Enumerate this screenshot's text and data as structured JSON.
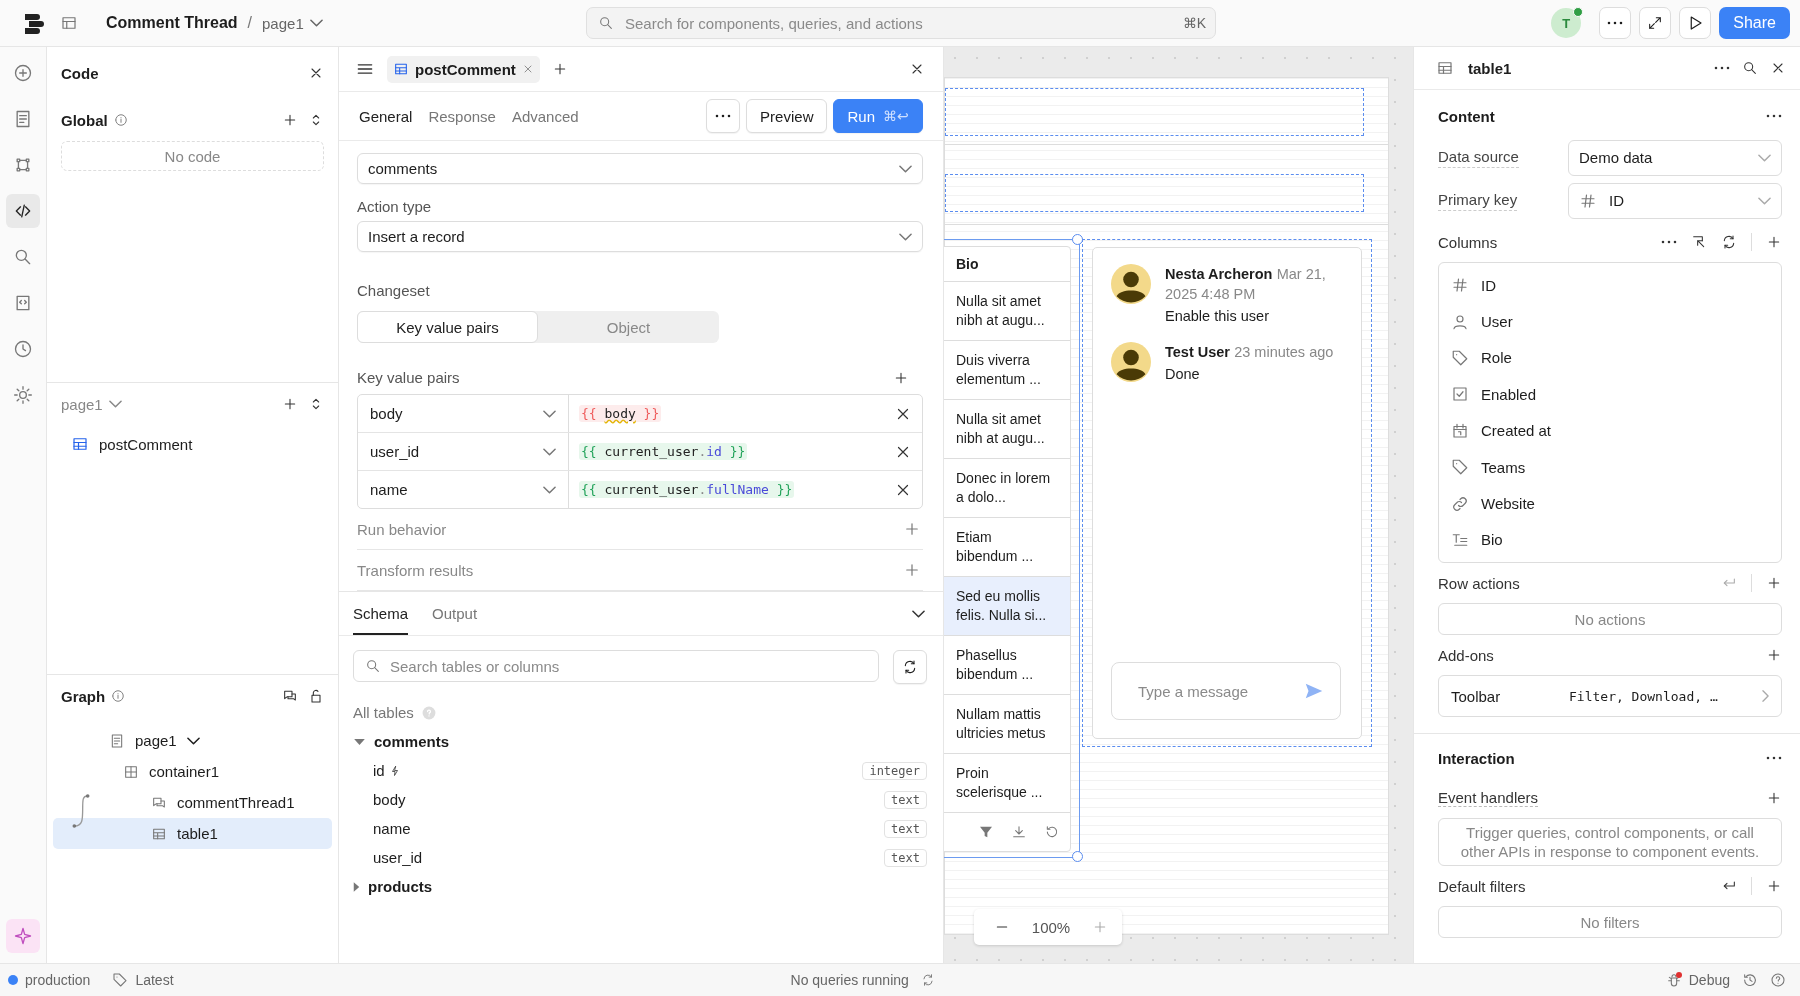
{
  "topbar": {
    "title": "Comment Thread",
    "separator": "/",
    "page": "page1",
    "search_placeholder": "Search for components, queries, and actions",
    "shortcut": "⌘K",
    "avatar": "T",
    "share": "Share"
  },
  "rail": [
    {
      "kind": "add",
      "selected": false
    },
    {
      "kind": "pages",
      "selected": false
    },
    {
      "kind": "components",
      "selected": false
    },
    {
      "kind": "code",
      "selected": true
    },
    {
      "kind": "search",
      "selected": false
    },
    {
      "kind": "files",
      "selected": false
    },
    {
      "kind": "history",
      "selected": false
    },
    {
      "kind": "settings",
      "selected": false
    }
  ],
  "code_panel": {
    "title": "Code",
    "global_label": "Global",
    "global_empty": "No code",
    "page_label": "page1",
    "queries": [
      {
        "name": "postComment"
      }
    ]
  },
  "graph": {
    "title": "Graph",
    "nodes": [
      {
        "name": "page1",
        "kind": "page",
        "selected": false,
        "children": [
          {
            "name": "container1",
            "kind": "container",
            "selected": false,
            "children": [
              {
                "name": "commentThread1",
                "kind": "thread",
                "selected": false
              },
              {
                "name": "table1",
                "kind": "table",
                "selected": true
              }
            ]
          }
        ]
      }
    ]
  },
  "query": {
    "tab": "postComment",
    "tabs": [
      {
        "label": "General",
        "selected": true
      },
      {
        "label": "Response",
        "selected": false
      },
      {
        "label": "Advanced",
        "selected": false
      }
    ],
    "preview": "Preview",
    "run": "Run",
    "run_shortcut": "⌘↩",
    "table_value": "comments",
    "action_label": "Action type",
    "action_value": "Insert a record",
    "changeset_label": "Changeset",
    "segments": [
      {
        "label": "Key value pairs",
        "selected": true
      },
      {
        "label": "Object",
        "selected": false
      }
    ],
    "pairs_label": "Key value pairs",
    "pairs": [
      {
        "key": "body",
        "valid": false,
        "tokens": [
          {
            "t": "{{ ",
            "kind": "brace"
          },
          {
            "t": "body",
            "kind": "ident"
          },
          {
            "t": " }}",
            "kind": "brace"
          }
        ]
      },
      {
        "key": "user_id",
        "valid": true,
        "tokens": [
          {
            "t": "{{ ",
            "kind": "brace"
          },
          {
            "t": "current_user",
            "kind": "ident"
          },
          {
            "t": ".",
            "kind": "dot"
          },
          {
            "t": "id",
            "kind": "prop"
          },
          {
            "t": " }}",
            "kind": "brace"
          }
        ]
      },
      {
        "key": "name",
        "valid": true,
        "tokens": [
          {
            "t": "{{ ",
            "kind": "brace"
          },
          {
            "t": "current_user",
            "kind": "ident"
          },
          {
            "t": ".",
            "kind": "dot"
          },
          {
            "t": "fullName",
            "kind": "prop"
          },
          {
            "t": " }}",
            "kind": "brace"
          }
        ]
      }
    ],
    "sections": [
      {
        "label": "Run behavior"
      },
      {
        "label": "Transform results"
      }
    ]
  },
  "schema": {
    "tabs": [
      {
        "label": "Schema",
        "selected": true
      },
      {
        "label": "Output",
        "selected": false
      }
    ],
    "search_placeholder": "Search tables or columns",
    "all_tables": "All tables",
    "tables": [
      {
        "name": "comments",
        "expanded": true,
        "columns": [
          {
            "name": "id",
            "primary": true,
            "type": "integer"
          },
          {
            "name": "body",
            "primary": false,
            "type": "text"
          },
          {
            "name": "name",
            "primary": false,
            "type": "text"
          },
          {
            "name": "user_id",
            "primary": false,
            "type": "text"
          }
        ]
      },
      {
        "name": "products",
        "expanded": false
      }
    ]
  },
  "canvas": {
    "table": {
      "header": "Bio",
      "rows": [
        {
          "text": "Nulla sit amet nibh at augu...",
          "selected": false
        },
        {
          "text": "Duis viverra elementum ...",
          "selected": false
        },
        {
          "text": "Nulla sit amet nibh at augu...",
          "selected": false
        },
        {
          "text": "Donec in lorem a dolo...",
          "selected": false
        },
        {
          "text": "Etiam bibendum ...",
          "selected": false
        },
        {
          "text": "Sed eu mollis felis. Nulla si...",
          "selected": true
        },
        {
          "text": "Phasellus bibendum ...",
          "selected": false
        },
        {
          "text": "Nullam mattis ultricies metus",
          "selected": false
        },
        {
          "text": "Proin scelerisque ...",
          "selected": false
        }
      ]
    },
    "thread": {
      "comments": [
        {
          "author": "Nesta Archeron",
          "time": "Mar 21, 2025 4:48 PM",
          "body": "Enable this user"
        },
        {
          "author": "Test User",
          "time": "23 minutes ago",
          "body": "Done"
        }
      ],
      "placeholder": "Type a message"
    },
    "zoom": "100%"
  },
  "inspector": {
    "title": "table1",
    "content_title": "Content",
    "data_source_label": "Data source",
    "data_source": "Demo data",
    "primary_key_label": "Primary key",
    "primary_key": "ID",
    "columns_label": "Columns",
    "columns": [
      {
        "name": "ID",
        "kind": "number"
      },
      {
        "name": "User",
        "kind": "user"
      },
      {
        "name": "Role",
        "kind": "tag"
      },
      {
        "name": "Enabled",
        "kind": "boolean"
      },
      {
        "name": "Created at",
        "kind": "date"
      },
      {
        "name": "Teams",
        "kind": "tag"
      },
      {
        "name": "Website",
        "kind": "link"
      },
      {
        "name": "Bio",
        "kind": "text"
      }
    ],
    "row_actions_label": "Row actions",
    "row_actions_empty": "No actions",
    "addons_label": "Add-ons",
    "addons": [
      {
        "name": "Toolbar",
        "value": "Filter, Download, …"
      }
    ],
    "interaction_title": "Interaction",
    "event_handlers_label": "Event handlers",
    "event_handlers_hint": "Trigger queries, control components, or call other APIs in response to component events.",
    "default_filters_label": "Default filters",
    "default_filters_empty": "No filters"
  },
  "status": {
    "environment": "production",
    "release": "Latest",
    "queries": "No queries running",
    "debug": "Debug"
  }
}
